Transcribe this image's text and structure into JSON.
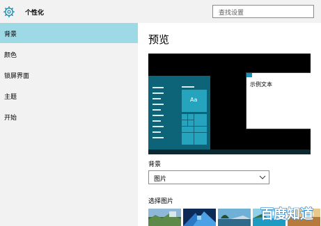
{
  "window": {
    "title": "个性化",
    "search_placeholder": "查找设置"
  },
  "sidebar": {
    "items": [
      {
        "label": "背景",
        "active": true
      },
      {
        "label": "颜色",
        "active": false
      },
      {
        "label": "锁屏界面",
        "active": false
      },
      {
        "label": "主题",
        "active": false
      },
      {
        "label": "开始",
        "active": false
      }
    ]
  },
  "main": {
    "heading": "预览",
    "preview_sample_text": "示例文本",
    "preview_tile_label": "Aa",
    "background_label": "背景",
    "background_value": "图片",
    "choose_picture_label": "选择图片"
  },
  "colors": {
    "accent": "#0d6478",
    "sidebar_selected": "#9ed9e6",
    "tile": "#26a4bd"
  },
  "watermark": {
    "text": "百度知道"
  }
}
